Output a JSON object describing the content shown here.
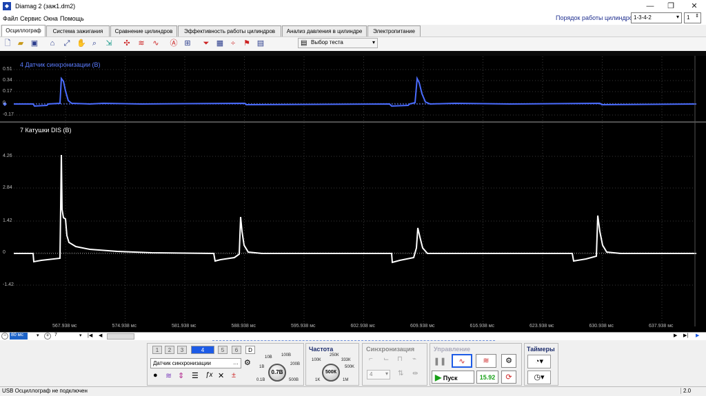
{
  "app": {
    "title": "Diamag 2 (заж1.dm2)"
  },
  "menu": [
    "Файл",
    "Сервис",
    "Окна",
    "Помощь"
  ],
  "cylinder": {
    "label": "Порядок работы цилиндров",
    "order": "1-3-4-2",
    "count": "1"
  },
  "tabs": [
    "Осциллограф",
    "Система зажигания",
    "Сравнение цилиндров",
    "Эффективность работы цилиндров",
    "Анализ давления в цилиндре",
    "Электропитание"
  ],
  "toolbar": {
    "test_select": "Выбор теста"
  },
  "channels": {
    "ch4": "4 Датчик синхронизации (В)",
    "ch7": "7 Катушки DIS (В)"
  },
  "ch4_ticks": [
    "0.51",
    "0.34",
    "0.17",
    "0",
    "-0.17"
  ],
  "ch7_ticks": [
    "4.26",
    "2.84",
    "1.42",
    "0",
    "-1.42"
  ],
  "x_ticks": [
    "567.938 мс",
    "574.938 мс",
    "581.938 мс",
    "588.938 мс",
    "595.938 мс",
    "602.938 мс",
    "609.938 мс",
    "616.938 мс",
    "623.938 мс",
    "630.938 мс",
    "637.938 мс"
  ],
  "scroll": {
    "zoom": "80 мс",
    "channel": "7"
  },
  "channel_buttons": [
    "1",
    "2",
    "3",
    "4",
    "5",
    "6",
    "D"
  ],
  "sync_sensor": "Датчик синхронизации",
  "voltage": {
    "value": "0.7В",
    "labels": [
      "10В",
      "100В",
      "1В",
      "200В",
      "0.1В",
      "500В"
    ]
  },
  "frequency": {
    "title": "Частота",
    "value": "500К",
    "labels": [
      "250К",
      "100К",
      "333К",
      "500K",
      "1K",
      "1M"
    ]
  },
  "sync": {
    "title": "Синхронизация",
    "channel": "4"
  },
  "control": {
    "title": "Управление",
    "start": "Пуск",
    "value": "15.92"
  },
  "timers": {
    "title": "Таймеры"
  },
  "status": {
    "text": "USB Осциллограф не подключен",
    "version": "2.0"
  },
  "colors": {
    "ch4": "#4a6cff",
    "ch7": "#ffffff",
    "accent": "#1d5be6"
  }
}
